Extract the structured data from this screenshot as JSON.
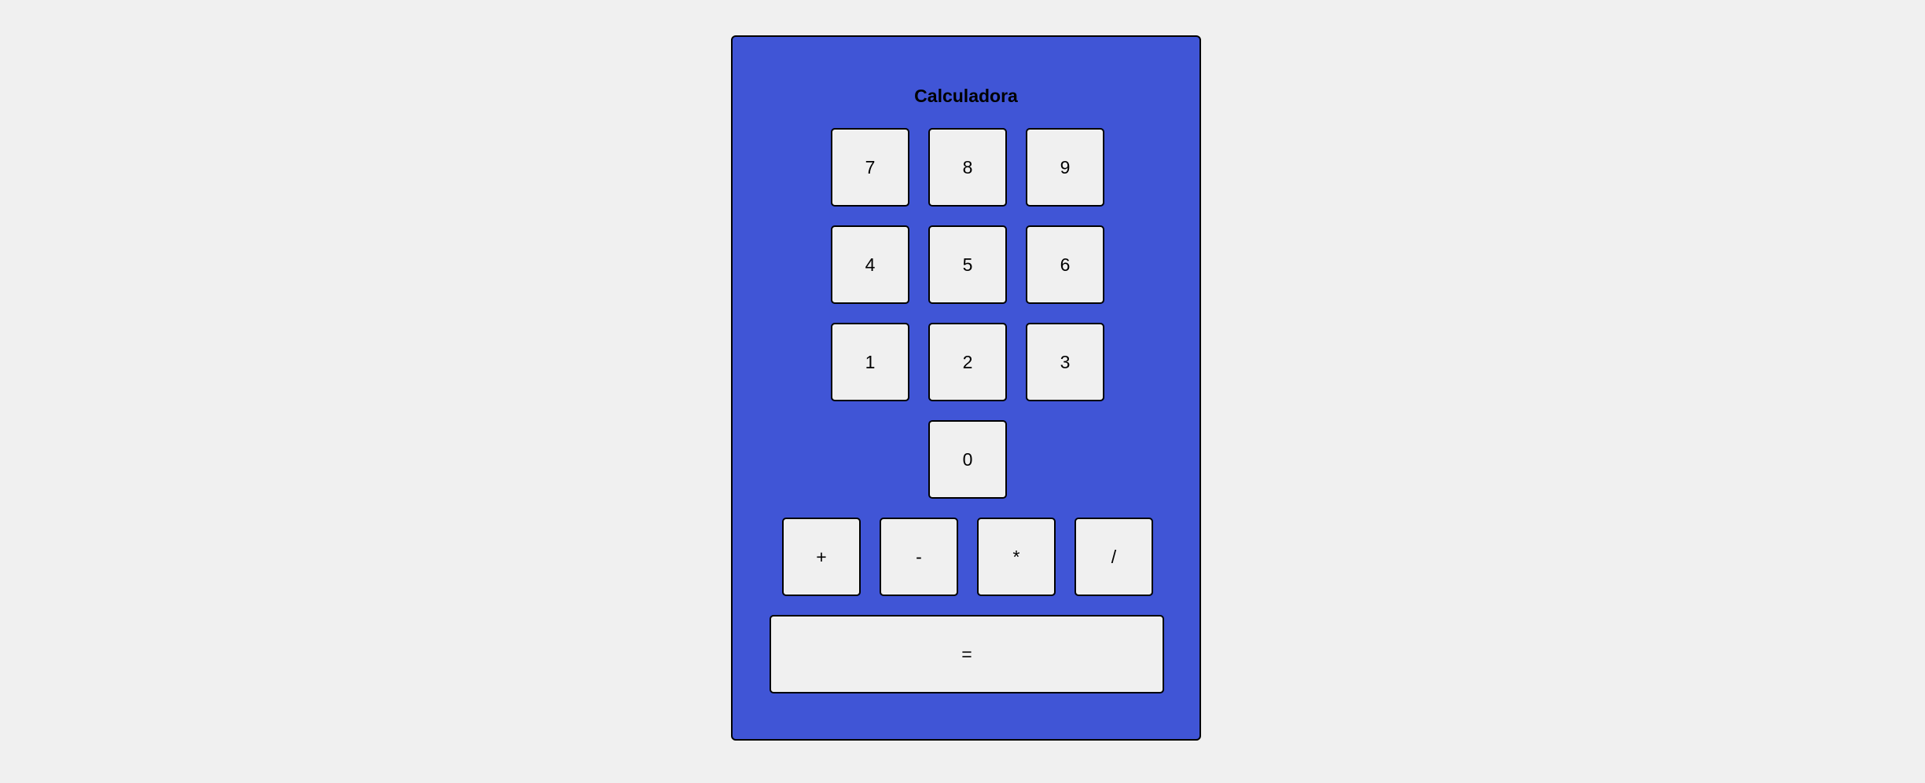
{
  "calculator": {
    "title": "Calculadora",
    "digits": {
      "d7": "7",
      "d8": "8",
      "d9": "9",
      "d4": "4",
      "d5": "5",
      "d6": "6",
      "d1": "1",
      "d2": "2",
      "d3": "3",
      "d0": "0"
    },
    "operators": {
      "add": "+",
      "subtract": "-",
      "multiply": "*",
      "divide": "/"
    },
    "equals": "="
  },
  "colors": {
    "page_background": "#f0f0f0",
    "calculator_background": "#4055d6",
    "button_background": "#f0f0f0"
  }
}
